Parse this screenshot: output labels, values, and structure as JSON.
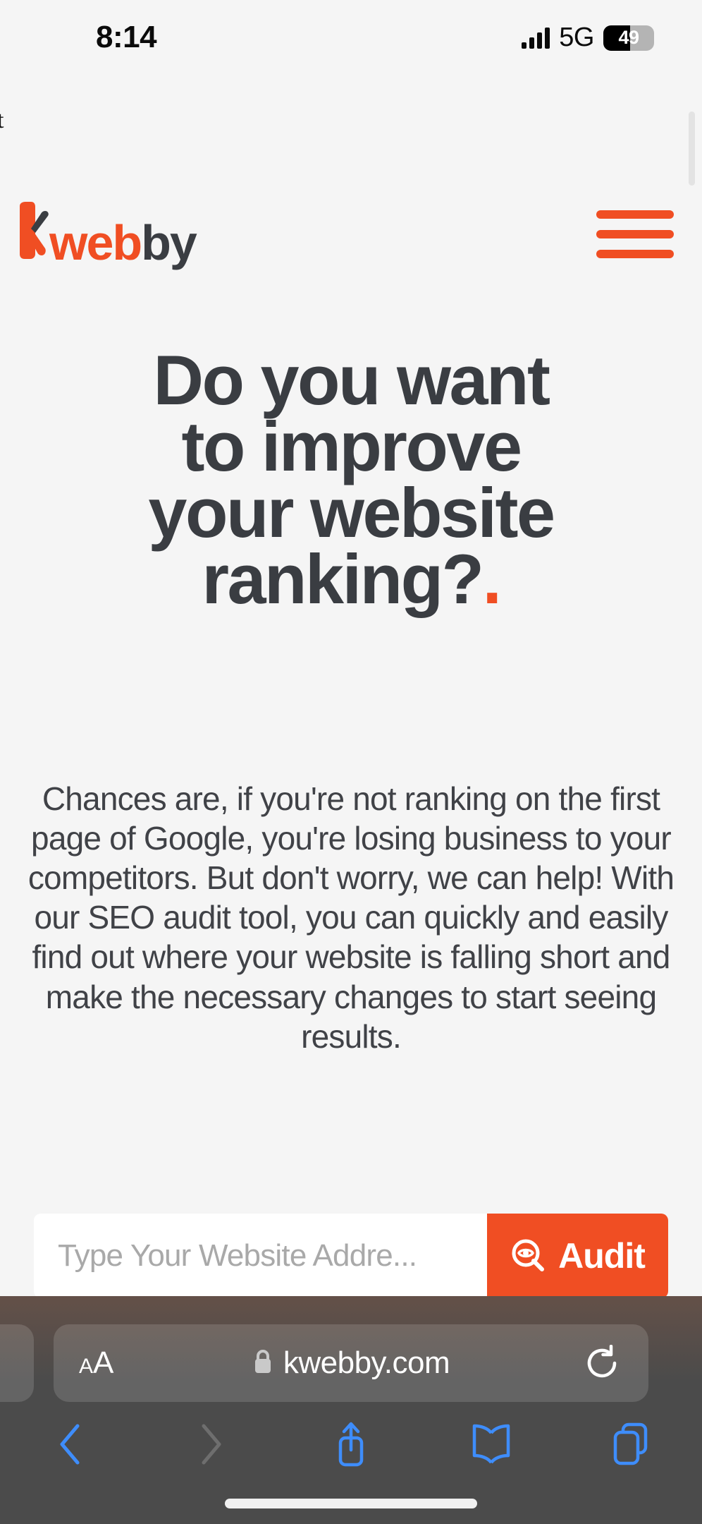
{
  "status_bar": {
    "time": "8:14",
    "network": "5G",
    "battery_level": "49",
    "signal_icon": "signal-bars-icon",
    "battery_icon": "battery-icon"
  },
  "page": {
    "clipped_text": "t",
    "background_color": "#f5f5f5",
    "accent_color": "#f04e23",
    "text_color": "#3a3d42"
  },
  "site_header": {
    "logo": {
      "part_k": "k",
      "part_web": "web",
      "part_by": "by",
      "full": "kwebby"
    },
    "menu_icon": "hamburger-menu-icon"
  },
  "hero": {
    "heading_line_1": "Do you want",
    "heading_line_2": "to improve",
    "heading_line_3": "your website",
    "heading_line_4": "ranking?",
    "heading_accent": ".",
    "paragraph": "Chances are, if you're not ranking on the first page of Google, you're losing business to your competitors. But don't worry, we can help! With our SEO audit tool, you can quickly and easily find out where your website is falling short and make the necessary changes to start seeing results."
  },
  "audit_form": {
    "input_placeholder": "Type Your Website Addre...",
    "input_value": "",
    "button_label": "Audit",
    "button_icon": "target-eye-icon",
    "button_color": "#f04e23"
  },
  "safari": {
    "text_size_small": "A",
    "text_size_large": "A",
    "lock_icon": "lock-icon",
    "url": "kwebby.com",
    "reload_icon": "reload-icon",
    "toolbar": {
      "back_icon": "chevron-left-icon",
      "forward_icon": "chevron-right-icon",
      "share_icon": "share-icon",
      "bookmarks_icon": "book-icon",
      "tabs_icon": "tabs-icon"
    }
  }
}
